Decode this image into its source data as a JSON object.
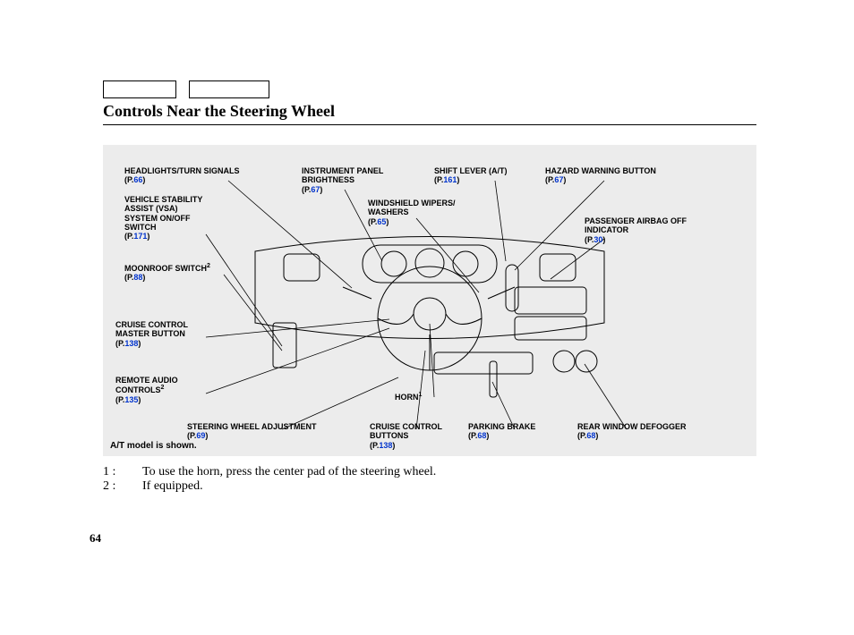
{
  "title": "Controls Near the Steering Wheel",
  "page_number": "64",
  "model_note": "A/T model is shown.",
  "callouts": {
    "headlights": {
      "label": "HEADLIGHTS/TURN SIGNALS",
      "page": "66"
    },
    "instrument_panel": {
      "label": "INSTRUMENT PANEL\nBRIGHTNESS",
      "page": "67"
    },
    "shift_lever": {
      "label": "SHIFT LEVER (A/T)",
      "page": "161"
    },
    "hazard": {
      "label": "HAZARD WARNING BUTTON",
      "page": "67"
    },
    "vsa": {
      "label": "VEHICLE STABILITY\nASSIST (VSA)\nSYSTEM ON/OFF\nSWITCH",
      "page": "171"
    },
    "wipers": {
      "label": "WINDSHIELD WIPERS/\nWASHERS",
      "page": "65"
    },
    "passenger_airbag": {
      "label": "PASSENGER AIRBAG OFF\nINDICATOR",
      "page": "30"
    },
    "moonroof": {
      "label": "MOONROOF SWITCH",
      "sup": "2",
      "page": "88"
    },
    "cruise_master": {
      "label": "CRUISE CONTROL\nMASTER BUTTON",
      "page": "138"
    },
    "remote_audio": {
      "label": "REMOTE AUDIO\nCONTROLS",
      "sup": "2",
      "page": "135"
    },
    "horn": {
      "label": "HORN",
      "sup": "1"
    },
    "steering_adj": {
      "label": "STEERING WHEEL ADJUSTMENT",
      "page": "69"
    },
    "cruise_buttons": {
      "label": "CRUISE CONTROL\nBUTTONS",
      "page": "138"
    },
    "parking_brake": {
      "label": "PARKING BRAKE",
      "page": "68"
    },
    "rear_defogger": {
      "label": "REAR WINDOW DEFOGGER",
      "page": "68"
    }
  },
  "notes": {
    "n1": {
      "idx": "1 :",
      "text": "To use the horn, press the center pad of the steering wheel."
    },
    "n2": {
      "idx": "2 :",
      "text": "If equipped."
    }
  }
}
